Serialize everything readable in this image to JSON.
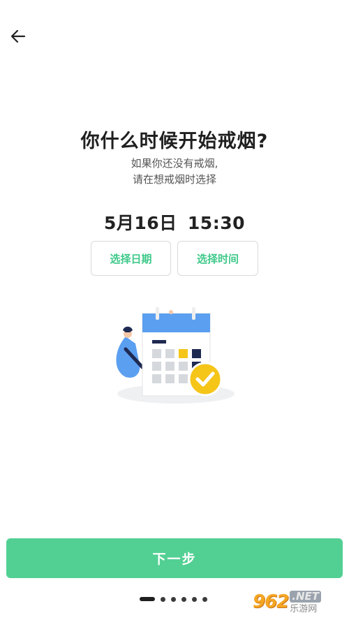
{
  "header": {
    "back_icon": "arrow-left-icon"
  },
  "question": "你什么时候开始戒烟?",
  "hint": {
    "line1": "如果你还没有戒烟,",
    "line2": "请在想戒烟时选择"
  },
  "selection": {
    "date": "5月16日",
    "time": "15:30"
  },
  "buttons": {
    "pick_date": "选择日期",
    "pick_time": "选择时间",
    "next": "下一步"
  },
  "illustration": {
    "icon": "calendar-check-illustration"
  },
  "pager": {
    "total": 6,
    "active_index": 0
  },
  "watermark": {
    "logo": "962",
    "net": ".NET",
    "site": "乐游网"
  },
  "colors": {
    "accent": "#52d093",
    "accent_text": "#3fc98a",
    "calendar_blue": "#5b9ff0",
    "check_yellow": "#f5c518"
  }
}
